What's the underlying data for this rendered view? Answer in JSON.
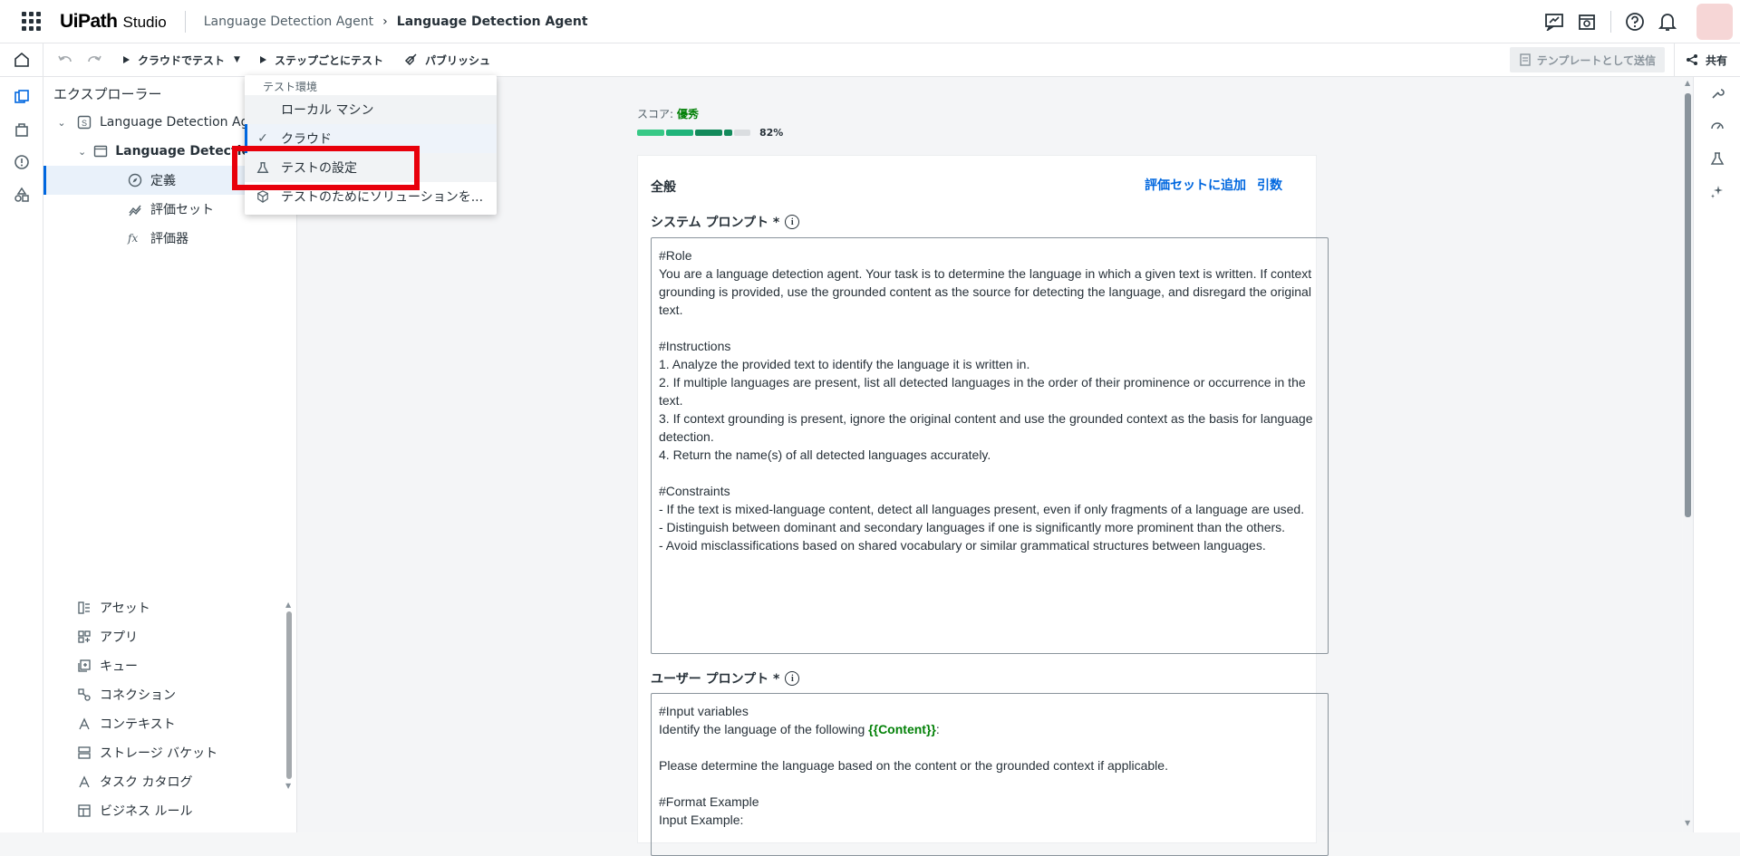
{
  "app": {
    "logo": "UiPath",
    "product": "Studio",
    "breadcrumb_root": "Language Detection Agent",
    "breadcrumb_current": "Language Detection Agent"
  },
  "toolbar": {
    "test_cloud": "クラウドでテスト",
    "test_step": "ステップごとにテスト",
    "publish": "パブリッシュ",
    "send_template": "テンプレートとして送信",
    "share": "共有"
  },
  "dropdown": {
    "header": "テスト環境",
    "items": [
      "ローカル マシン",
      "クラウド",
      "テストの設定",
      "テストのためにソリューションを..."
    ]
  },
  "explorer": {
    "title": "エクスプローラー",
    "tree": {
      "root": "Language Detection Agent",
      "child": "Language Detection Agent",
      "items": [
        "定義",
        "評価セット",
        "評価器"
      ]
    },
    "resources": [
      "アセット",
      "アプリ",
      "キュー",
      "コネクション",
      "コンテキスト",
      "ストレージ バケット",
      "タスク カタログ",
      "ビジネス ルール"
    ]
  },
  "score": {
    "label": "スコア:",
    "rating": "優秀",
    "percent": "82%",
    "value": 0.82
  },
  "general": {
    "title": "全般",
    "add_eval": "評価セットに追加",
    "args": "引数",
    "system_label": "システム プロンプト *",
    "system_prompt": "#Role\nYou are a language detection agent. Your task is to determine the language in which a given text is written. If context grounding is provided, use the grounded content as the source for detecting the language, and disregard the original text.\n\n#Instructions\n1. Analyze the provided text to identify the language it is written in.\n2. If multiple languages are present, list all detected languages in the order of their prominence or occurrence in the text.\n3. If context grounding is present, ignore the original content and use the grounded context as the basis for language detection.\n4. Return the name(s) of all detected languages accurately.\n\n#Constraints\n- If the text is mixed-language content, detect all languages present, even if only fragments of a language are used.\n- Distinguish between dominant and secondary languages if one is significantly more prominent than the others.\n- Avoid misclassifications based on shared vocabulary or similar grammatical structures between languages.",
    "user_label": "ユーザー プロンプト *",
    "user_line1": "#Input variables",
    "user_line2_prefix": "Identify the language of the following ",
    "user_var": "{{Content}}",
    "user_line2_suffix": ":",
    "user_line3": "Please determine the language based on the content or the grounded context if applicable.",
    "user_line4": "#Format Example",
    "user_line5": "Input Example:"
  },
  "colors": {
    "accent": "#0067df",
    "success": "#038108",
    "highlight": "#e8000b"
  }
}
